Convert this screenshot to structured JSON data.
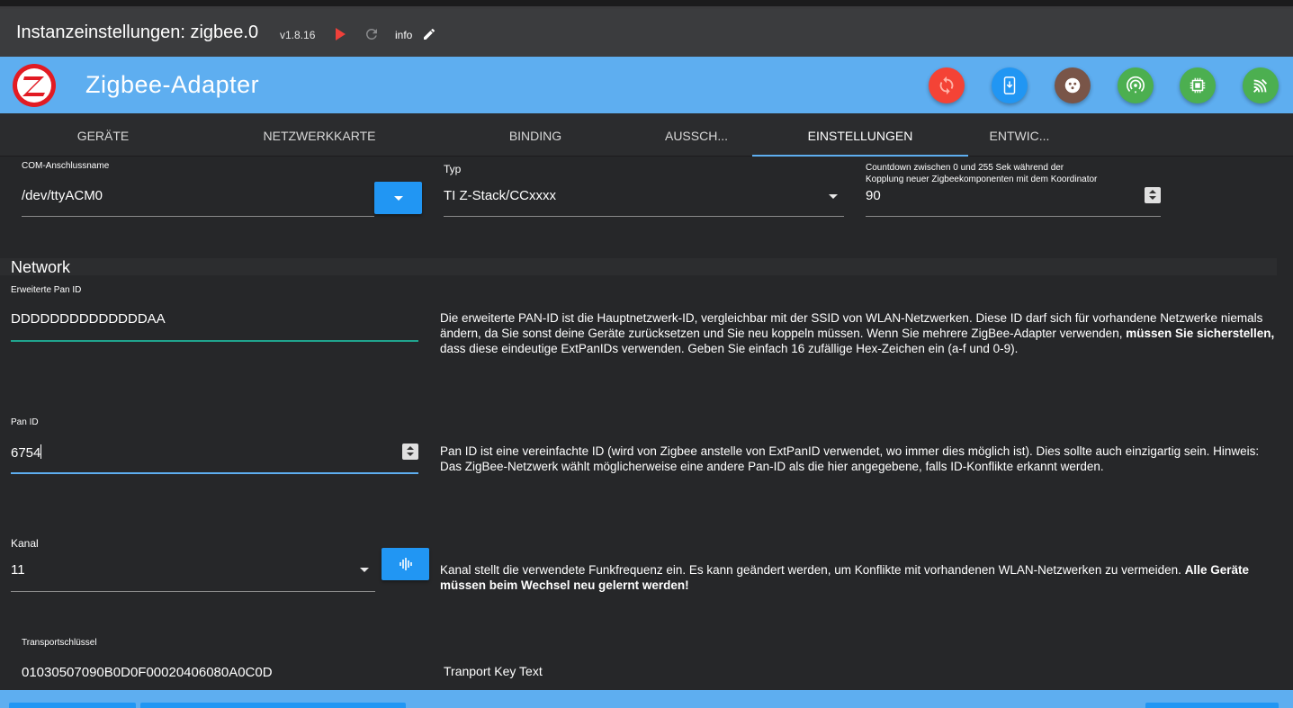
{
  "window": {
    "title": "Instanzeinstellungen: zigbee.0",
    "version": "v1.8.16",
    "info_label": "info"
  },
  "appbar": {
    "title": "Zigbee-Adapter",
    "buttons": [
      {
        "name": "reset-button",
        "icon": "sync-icon",
        "color": "#f44336"
      },
      {
        "name": "pairing-button",
        "icon": "phone-download-icon",
        "color": "#2196f3"
      },
      {
        "name": "hardware-button",
        "icon": "outlet-icon",
        "color": "#795548"
      },
      {
        "name": "zigbee-channel-button",
        "icon": "radio-tower-icon",
        "color": "#4caf50"
      },
      {
        "name": "firmware-button",
        "icon": "chip-icon",
        "color": "#4caf50"
      },
      {
        "name": "coordinator-button",
        "icon": "signal-icon",
        "color": "#4caf50"
      }
    ]
  },
  "tabs": [
    {
      "label": "Geräte",
      "active": false
    },
    {
      "label": "Netzwerkkarte",
      "active": false
    },
    {
      "label": "Binding",
      "active": false
    },
    {
      "label": "Aussch...",
      "active": false
    },
    {
      "label": "Einstellungen",
      "active": true
    },
    {
      "label": "Entwic...",
      "active": false
    }
  ],
  "form": {
    "com_port": {
      "label": "COM-Anschlussname",
      "value": "/dev/ttyACM0"
    },
    "type": {
      "label": "Typ",
      "value": "TI Z-Stack/CCxxxx"
    },
    "countdown": {
      "label": "Countdown zwischen 0 und 255 Sek während der Kopplung neuer Zigbeekomponenten mit dem Koordinator",
      "value": "90"
    }
  },
  "network": {
    "section_title": "Network",
    "ext_pan_id": {
      "label": "Erweiterte Pan ID",
      "value": "DDDDDDDDDDDDDDAA",
      "desc_1": "Die erweiterte PAN-ID ist die Hauptnetzwerk-ID, vergleichbar mit der SSID von WLAN-Netzwerken. Diese ID darf sich für vorhandene Netzwerke niemals ändern, da Sie sonst deine Geräte zurücksetzen und Sie neu koppeln müssen. Wenn Sie mehrere ZigBee-Adapter verwenden, ",
      "desc_bold": "müssen Sie sicherstellen,",
      "desc_2": " dass diese eindeutige ExtPanIDs verwenden. Geben Sie einfach 16 zufällige Hex-Zeichen ein (a-f und 0-9)."
    },
    "pan_id": {
      "label": "Pan ID",
      "value": "6754",
      "desc": "Pan ID ist eine vereinfachte ID (wird von Zigbee anstelle von ExtPanID verwendet, wo immer dies möglich ist). Dies sollte auch einzigartig sein. Hinweis: Das ZigBee-Netzwerk wählt möglicherweise eine andere Pan-ID als die hier angegebene, falls ID-Konflikte erkannt werden."
    },
    "channel": {
      "label": "Kanal",
      "value": "11",
      "desc_1": "Kanal stellt die verwendete Funkfrequenz ein. Es kann geändert werden, um Konflikte mit vorhandenen WLAN-Netzwerken zu vermeiden. ",
      "desc_bold": "Alle Geräte müssen beim Wechsel neu gelernt werden!"
    },
    "transport_key": {
      "label": "Transportschlüssel",
      "value": "01030507090B0D0F00020406080A0C0D",
      "desc": "Tranport Key Text"
    }
  }
}
